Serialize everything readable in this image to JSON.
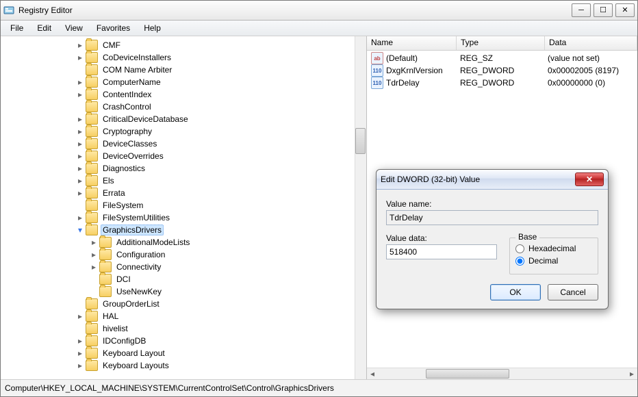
{
  "title": "Registry Editor",
  "menu": [
    "File",
    "Edit",
    "View",
    "Favorites",
    "Help"
  ],
  "tree": {
    "nodes": [
      {
        "label": "CMF",
        "depth": 0,
        "expander": "closed"
      },
      {
        "label": "CoDeviceInstallers",
        "depth": 0,
        "expander": "closed"
      },
      {
        "label": "COM Name Arbiter",
        "depth": 0,
        "expander": "none"
      },
      {
        "label": "ComputerName",
        "depth": 0,
        "expander": "closed"
      },
      {
        "label": "ContentIndex",
        "depth": 0,
        "expander": "closed"
      },
      {
        "label": "CrashControl",
        "depth": 0,
        "expander": "none"
      },
      {
        "label": "CriticalDeviceDatabase",
        "depth": 0,
        "expander": "closed"
      },
      {
        "label": "Cryptography",
        "depth": 0,
        "expander": "closed"
      },
      {
        "label": "DeviceClasses",
        "depth": 0,
        "expander": "closed"
      },
      {
        "label": "DeviceOverrides",
        "depth": 0,
        "expander": "closed"
      },
      {
        "label": "Diagnostics",
        "depth": 0,
        "expander": "closed"
      },
      {
        "label": "Els",
        "depth": 0,
        "expander": "closed"
      },
      {
        "label": "Errata",
        "depth": 0,
        "expander": "closed"
      },
      {
        "label": "FileSystem",
        "depth": 0,
        "expander": "none"
      },
      {
        "label": "FileSystemUtilities",
        "depth": 0,
        "expander": "closed"
      },
      {
        "label": "GraphicsDrivers",
        "depth": 0,
        "expander": "open",
        "selected": true
      },
      {
        "label": "AdditionalModeLists",
        "depth": 1,
        "expander": "closed"
      },
      {
        "label": "Configuration",
        "depth": 1,
        "expander": "closed"
      },
      {
        "label": "Connectivity",
        "depth": 1,
        "expander": "closed"
      },
      {
        "label": "DCI",
        "depth": 1,
        "expander": "none"
      },
      {
        "label": "UseNewKey",
        "depth": 1,
        "expander": "none"
      },
      {
        "label": "GroupOrderList",
        "depth": 0,
        "expander": "none"
      },
      {
        "label": "HAL",
        "depth": 0,
        "expander": "closed"
      },
      {
        "label": "hivelist",
        "depth": 0,
        "expander": "none"
      },
      {
        "label": "IDConfigDB",
        "depth": 0,
        "expander": "closed"
      },
      {
        "label": "Keyboard Layout",
        "depth": 0,
        "expander": "closed"
      },
      {
        "label": "Keyboard Layouts",
        "depth": 0,
        "expander": "closed"
      }
    ]
  },
  "list": {
    "columns": {
      "name": "Name",
      "type": "Type",
      "data": "Data"
    },
    "rows": [
      {
        "icon": "str",
        "name": "(Default)",
        "type": "REG_SZ",
        "data": "(value not set)"
      },
      {
        "icon": "num",
        "name": "DxgKrnlVersion",
        "type": "REG_DWORD",
        "data": "0x00002005 (8197)"
      },
      {
        "icon": "num",
        "name": "TdrDelay",
        "type": "REG_DWORD",
        "data": "0x00000000 (0)"
      }
    ]
  },
  "status_path": "Computer\\HKEY_LOCAL_MACHINE\\SYSTEM\\CurrentControlSet\\Control\\GraphicsDrivers",
  "dialog": {
    "title": "Edit DWORD (32-bit) Value",
    "value_name_label": "Value name:",
    "value_name": "TdrDelay",
    "value_data_label": "Value data:",
    "value_data": "518400",
    "base_label": "Base",
    "radio_hex": "Hexadecimal",
    "radio_dec": "Decimal",
    "selected_base": "dec",
    "ok": "OK",
    "cancel": "Cancel"
  },
  "icon_text": {
    "str": "ab",
    "num": "110"
  }
}
